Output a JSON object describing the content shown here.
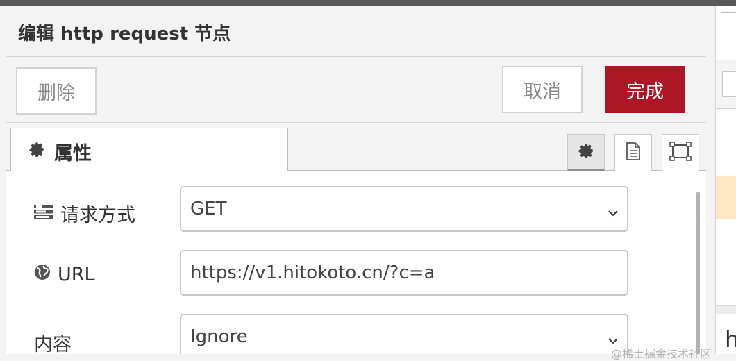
{
  "tray": {
    "title": "编辑 http request 节点",
    "buttons": {
      "delete": "删除",
      "cancel": "取消",
      "done": "完成"
    },
    "tabs": [
      {
        "label": "属性",
        "icon": "gear-icon"
      }
    ],
    "tab_icons": [
      "gear-icon",
      "description-icon",
      "appearance-icon"
    ]
  },
  "form": {
    "method": {
      "label": "请求方式",
      "icon": "tasks-icon",
      "value": "GET"
    },
    "url": {
      "label": "URL",
      "icon": "globe-icon",
      "value": "https://v1.hitokoto.cn/?c=a"
    },
    "payload": {
      "label": "内容",
      "value": "Ignore"
    }
  },
  "right_panel": {
    "partial_text": "h"
  },
  "watermark": "@稀土掘金技术社区",
  "colors": {
    "accent": "#ad1625",
    "highlight": "#fde8c8"
  }
}
